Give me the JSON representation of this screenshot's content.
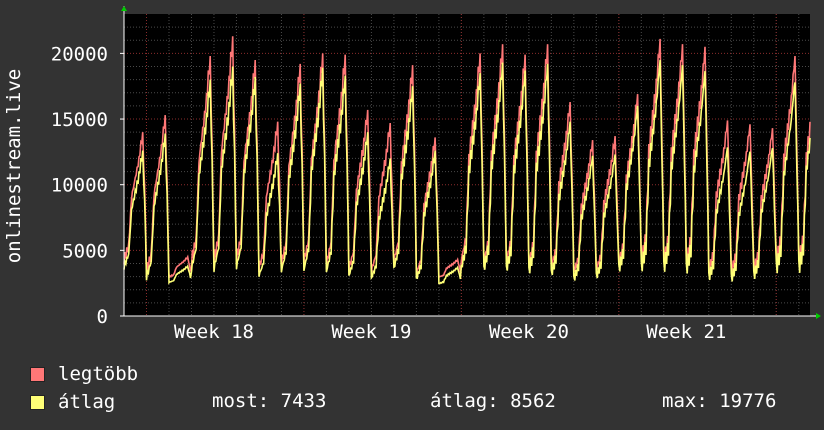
{
  "colors": {
    "background": "#333333",
    "plot_background": "#000000",
    "grid_major": "#8a2c2c",
    "grid_minor": "#4a4a4a",
    "series_max": "#ff7777",
    "series_avg": "#ffff77",
    "text": "#ffffff",
    "axis_arrow": "#00cc00"
  },
  "chart_data": {
    "type": "line",
    "ylabel": "onlinestream.live",
    "ylim": [
      0,
      23000
    ],
    "y_ticks": [
      0,
      5000,
      10000,
      15000,
      20000
    ],
    "y_tick_labels": [
      "0",
      "5000",
      "10000",
      "15000",
      "20000"
    ],
    "x_range_days": [
      0,
      30.5
    ],
    "x_tick_labels": [
      "Week 18",
      "Week 19",
      "Week 20",
      "Week 21"
    ],
    "x_tick_days": [
      4,
      11,
      18,
      25
    ],
    "grid": true,
    "series": [
      {
        "name": "legtöbb",
        "color": "#ff7777",
        "daily_peaks": [
          14000,
          15300,
          4500,
          19800,
          21300,
          19500,
          14800,
          19200,
          20000,
          19900,
          15700,
          14700,
          19100,
          13600,
          4300,
          20000,
          20700,
          19900,
          20700,
          16300,
          13400,
          13700,
          16900,
          21100,
          20700,
          20500,
          14900,
          14600,
          14300,
          19800,
          20000,
          14300,
          14800,
          13400,
          15200
        ],
        "daily_troughs": [
          3800,
          2800,
          2900,
          3400,
          3300,
          3600,
          3100,
          3200,
          3300,
          3100,
          3000,
          2900,
          3400,
          2700,
          2900,
          3500,
          3200,
          3300,
          3000,
          3100,
          2800,
          3000,
          3400,
          3400,
          3300,
          3200,
          2900,
          2800,
          3000,
          3300,
          3300,
          3200,
          3000,
          2700,
          2800
        ]
      },
      {
        "name": "átlag",
        "color": "#ffff77",
        "daily_peaks": [
          12600,
          13900,
          3800,
          18000,
          19000,
          18200,
          12400,
          17700,
          18900,
          18300,
          14000,
          12000,
          17500,
          12600,
          3700,
          18500,
          19300,
          18700,
          19200,
          14800,
          12200,
          12300,
          16000,
          19500,
          19100,
          18700,
          12900,
          12600,
          12900,
          18000,
          18800,
          12900,
          13000,
          12000,
          11700
        ],
        "daily_troughs": [
          3300,
          2400,
          2500,
          2900,
          2800,
          3000,
          2600,
          2700,
          2700,
          2600,
          2500,
          2400,
          2900,
          2300,
          2400,
          2900,
          2700,
          2700,
          2500,
          2600,
          2300,
          2500,
          2900,
          2800,
          2800,
          2700,
          2400,
          2300,
          2500,
          2800,
          2800,
          2700,
          2500,
          2300,
          2300
        ]
      }
    ],
    "legend": {
      "placement": "bottom-left",
      "entries": [
        {
          "label": "legtöbb",
          "color": "#ff7777"
        },
        {
          "label": "átlag",
          "color": "#ffff77"
        }
      ]
    },
    "stats": {
      "most": "most: 7433",
      "atlag": "átlag: 8562",
      "max": "max: 19776"
    }
  }
}
